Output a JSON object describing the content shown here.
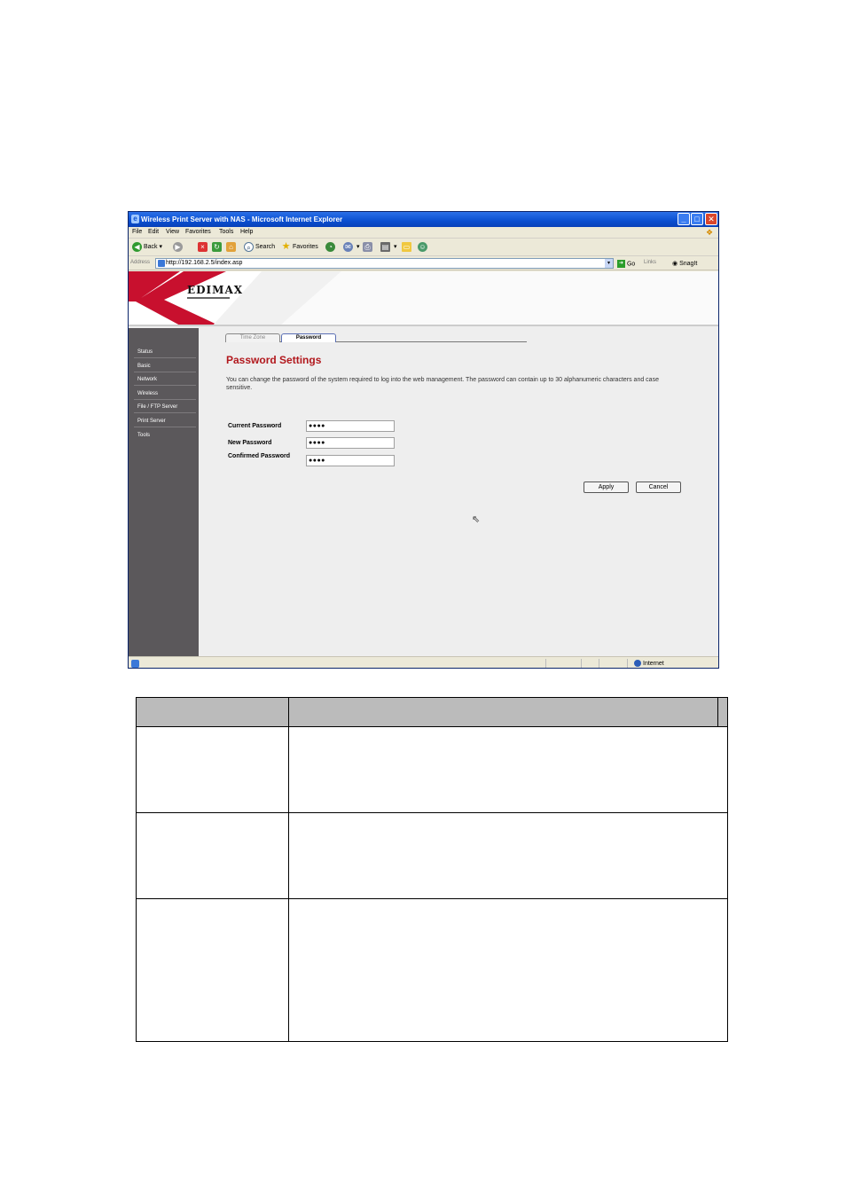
{
  "window": {
    "title": "Wireless Print Server with NAS - Microsoft Internet Explorer",
    "minimize": "_",
    "maximize": "□",
    "close": "✕"
  },
  "menu": [
    "File",
    "Edit",
    "View",
    "Favorites",
    "Tools",
    "Help"
  ],
  "toolbar": {
    "back": "Back",
    "search": "Search",
    "favorites": "Favorites"
  },
  "address": {
    "label": "Address",
    "url": "http://192.168.2.5/index.asp",
    "go": "Go",
    "links": "Links",
    "snagit": "SnagIt"
  },
  "brand": {
    "logo": "EDIMAX"
  },
  "sidebar": {
    "items": [
      {
        "label": "Status"
      },
      {
        "label": "Basic"
      },
      {
        "label": "Network"
      },
      {
        "label": "Wireless"
      },
      {
        "label": "File / FTP Server"
      },
      {
        "label": "Print Server"
      },
      {
        "label": "Tools"
      }
    ]
  },
  "tabs": [
    {
      "label": "Time Zone"
    },
    {
      "label": "Password"
    }
  ],
  "page": {
    "heading": "Password Settings",
    "intro": "You can change the password of the system required to log into the web management. The password can contain up to 30 alphanumeric characters and case sensitive."
  },
  "form": {
    "current_label": "Current Password",
    "current_value": "●●●●",
    "new_label": "New Password",
    "new_value": "●●●●",
    "confirm_label": "Confirmed Password",
    "confirm_value": "●●●●",
    "apply": "Apply",
    "cancel": "Cancel"
  },
  "status": {
    "zone": "Internet"
  }
}
